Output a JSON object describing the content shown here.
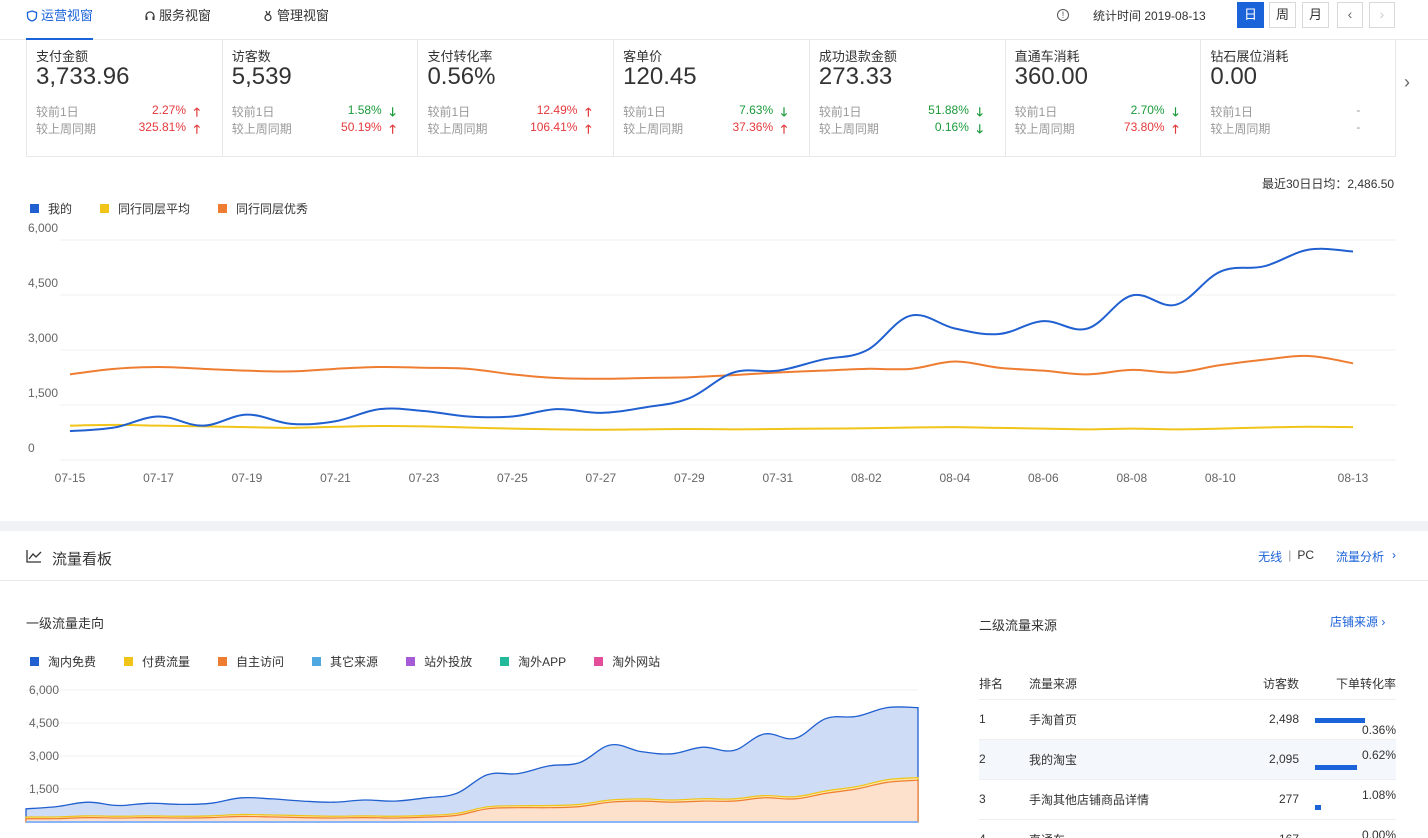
{
  "tabs": [
    {
      "label": "运营视窗",
      "active": true
    },
    {
      "label": "服务视窗",
      "active": false
    },
    {
      "label": "管理视窗",
      "active": false
    }
  ],
  "header": {
    "stat_time": "统计时间 2019-08-13",
    "periods": [
      "日",
      "周",
      "月"
    ],
    "prev": "‹",
    "next": "›"
  },
  "metrics": [
    {
      "label": "支付金额",
      "value": "3,733.96",
      "r1_label": "较前1日",
      "r1_val": "2.27%",
      "r1_dir": "up",
      "r2_label": "较上周同期",
      "r2_val": "325.81%",
      "r2_dir": "up"
    },
    {
      "label": "访客数",
      "value": "5,539",
      "r1_label": "较前1日",
      "r1_val": "1.58%",
      "r1_dir": "down",
      "r2_label": "较上周同期",
      "r2_val": "50.19%",
      "r2_dir": "up"
    },
    {
      "label": "支付转化率",
      "value": "0.56%",
      "r1_label": "较前1日",
      "r1_val": "12.49%",
      "r1_dir": "up",
      "r2_label": "较上周同期",
      "r2_val": "106.41%",
      "r2_dir": "up"
    },
    {
      "label": "客单价",
      "value": "120.45",
      "r1_label": "较前1日",
      "r1_val": "7.63%",
      "r1_dir": "down",
      "r2_label": "较上周同期",
      "r2_val": "37.36%",
      "r2_dir": "up"
    },
    {
      "label": "成功退款金额",
      "value": "273.33",
      "r1_label": "较前1日",
      "r1_val": "51.88%",
      "r1_dir": "down",
      "r2_label": "较上周同期",
      "r2_val": "0.16%",
      "r2_dir": "down"
    },
    {
      "label": "直通车消耗",
      "value": "360.00",
      "r1_label": "较前1日",
      "r1_val": "2.70%",
      "r1_dir": "down",
      "r2_label": "较上周同期",
      "r2_val": "73.80%",
      "r2_dir": "up"
    },
    {
      "label": "钻石展位消耗",
      "value": "0.00",
      "r1_label": "较前1日",
      "r1_val": "-",
      "r1_dir": "none",
      "r2_label": "较上周同期",
      "r2_val": "-",
      "r2_dir": "none"
    }
  ],
  "avg_text": "最近30日日均：2,486.50",
  "colors": {
    "mine": "#2060d0",
    "avg": "#f0c419",
    "best": "#ef7d31",
    "blue": "#1b63d8"
  },
  "chart_data": [
    {
      "type": "line",
      "x": [
        "07-15",
        "07-16",
        "07-17",
        "07-18",
        "07-19",
        "07-20",
        "07-21",
        "07-22",
        "07-23",
        "07-24",
        "07-25",
        "07-26",
        "07-27",
        "07-28",
        "07-29",
        "07-30",
        "07-31",
        "08-01",
        "08-02",
        "08-03",
        "08-04",
        "08-05",
        "08-06",
        "08-07",
        "08-08",
        "08-09",
        "08-10",
        "08-11",
        "08-12",
        "08-13"
      ],
      "tick_labels": [
        "07-15",
        "07-17",
        "07-19",
        "07-21",
        "07-23",
        "07-25",
        "07-27",
        "07-29",
        "07-31",
        "08-02",
        "08-04",
        "08-06",
        "08-08",
        "08-10",
        "08-13"
      ],
      "yticks": [
        "6,000",
        "4,500",
        "3,000",
        "1,500",
        "0"
      ],
      "ylim": [
        0,
        6000
      ],
      "series": [
        {
          "name": "我的",
          "values": [
            650,
            750,
            1050,
            800,
            1100,
            850,
            920,
            1250,
            1200,
            1050,
            1050,
            1250,
            1150,
            1300,
            1550,
            2250,
            2300,
            2600,
            2850,
            3800,
            3450,
            3300,
            3650,
            3450,
            4350,
            4100,
            5000,
            5150,
            5600,
            5550
          ]
        },
        {
          "name": "同行同层平均",
          "values": [
            800,
            820,
            800,
            780,
            760,
            740,
            770,
            790,
            780,
            750,
            720,
            700,
            690,
            700,
            710,
            700,
            710,
            720,
            730,
            750,
            760,
            740,
            720,
            700,
            720,
            700,
            720,
            750,
            770,
            760
          ]
        },
        {
          "name": "同行同层优秀",
          "values": [
            2200,
            2350,
            2400,
            2350,
            2300,
            2280,
            2350,
            2400,
            2380,
            2350,
            2200,
            2100,
            2080,
            2100,
            2120,
            2180,
            2250,
            2300,
            2350,
            2350,
            2550,
            2380,
            2300,
            2200,
            2320,
            2250,
            2450,
            2600,
            2700,
            2500
          ]
        }
      ]
    },
    {
      "type": "area",
      "yticks": [
        "6,000",
        "4,500",
        "3,000",
        "1,500",
        "0"
      ],
      "ylim": [
        0,
        6000
      ],
      "series": [
        {
          "name": "淘内免费",
          "values": [
            600,
            700,
            900,
            750,
            850,
            800,
            850,
            1100,
            1050,
            950,
            900,
            1000,
            950,
            1100,
            1300,
            2150,
            2200,
            2550,
            2700,
            3500,
            3200,
            3100,
            3400,
            3250,
            4000,
            3800,
            4700,
            4800,
            5200,
            5200
          ]
        },
        {
          "name": "付费流量",
          "values": [
            80,
            80,
            80,
            80,
            80,
            80,
            80,
            90,
            90,
            90,
            80,
            80,
            80,
            80,
            90,
            90,
            90,
            100,
            100,
            100,
            100,
            100,
            110,
            100,
            100,
            100,
            110,
            110,
            120,
            120
          ]
        },
        {
          "name": "自主访问",
          "values": [
            150,
            150,
            200,
            180,
            200,
            180,
            200,
            250,
            230,
            200,
            180,
            200,
            180,
            220,
            300,
            600,
            650,
            650,
            700,
            900,
            950,
            900,
            950,
            950,
            1100,
            1050,
            1300,
            1500,
            1800,
            1900
          ]
        },
        {
          "name": "其它来源",
          "values": []
        },
        {
          "name": "站外投放",
          "values": []
        },
        {
          "name": "淘外APP",
          "values": []
        },
        {
          "name": "淘外网站",
          "values": []
        }
      ]
    }
  ],
  "legend1": [
    {
      "label": "我的",
      "color": "#2060d0"
    },
    {
      "label": "同行同层平均",
      "color": "#f0c419"
    },
    {
      "label": "同行同层优秀",
      "color": "#ef7d31"
    }
  ],
  "panel2": {
    "title": "流量看板",
    "link_wireless": "无线",
    "link_pc": "PC",
    "link_analysis": "流量分析",
    "sub_left": "一级流量走向",
    "sub_right": "二级流量来源",
    "sub_right_link": "店铺来源"
  },
  "legend2": [
    {
      "label": "淘内免费",
      "color": "#2060d0"
    },
    {
      "label": "付费流量",
      "color": "#f0c419"
    },
    {
      "label": "自主访问",
      "color": "#ef7d31"
    },
    {
      "label": "其它来源",
      "color": "#4fa8e0"
    },
    {
      "label": "站外投放",
      "color": "#a65bd6"
    },
    {
      "label": "淘外APP",
      "color": "#22b99a"
    },
    {
      "label": "淘外网站",
      "color": "#e44d9a"
    }
  ],
  "source_table": {
    "headers": [
      "排名",
      "流量来源",
      "访客数",
      "下单转化率"
    ],
    "rows": [
      {
        "rank": "1",
        "source": "手淘首页",
        "visitors": "2,498",
        "bar": 0.5,
        "rate": "0.36%"
      },
      {
        "rank": "2",
        "source": "我的淘宝",
        "visitors": "2,095",
        "bar": 0.42,
        "rate": "0.62%"
      },
      {
        "rank": "3",
        "source": "手淘其他店铺商品详情",
        "visitors": "277",
        "bar": 0.06,
        "rate": "1.08%"
      },
      {
        "rank": "4",
        "source": "直通车",
        "visitors": "167",
        "bar": 0.03,
        "rate": "0.00%"
      }
    ]
  }
}
